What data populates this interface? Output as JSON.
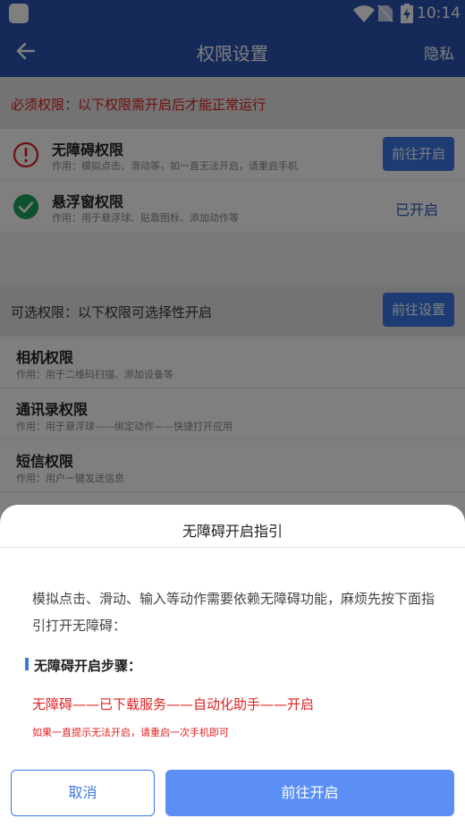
{
  "status_bar": {
    "time": "10:14"
  },
  "app_bar": {
    "title": "权限设置",
    "right_action": "隐私"
  },
  "required_section": {
    "header": "必须权限：以下权限需开启后才能正常运行",
    "items": [
      {
        "title": "无障碍权限",
        "desc": "作用：模拟点击、滑动等，如一直无法开启，请重启手机",
        "action": "前往开启",
        "state": "off",
        "icon": "alert-icon"
      },
      {
        "title": "悬浮窗权限",
        "desc": "作用：用于悬浮球、贴靠图标、添加动作等",
        "status": "已开启",
        "state": "on",
        "icon": "check-icon"
      }
    ]
  },
  "optional_section": {
    "header": "可选权限：以下权限可选择性开启",
    "action": "前往设置",
    "items": [
      {
        "title": "相机权限",
        "desc": "作用：用于二维码扫描、添加设备等"
      },
      {
        "title": "通讯录权限",
        "desc": "作用：用于悬浮球——绑定动作——快捷打开应用"
      },
      {
        "title": "短信权限",
        "desc": "作用：用户一键发送信息"
      }
    ]
  },
  "dialog": {
    "title": "无障碍开启指引",
    "body": "模拟点击、滑动、输入等动作需要依赖无障碍功能，麻烦先按下面指引打开无障碍：",
    "steps_title": "无障碍开启步骤：",
    "path": "无障碍——已下载服务——自动化助手——开启",
    "tip": "如果一直提示无法开启，请重启一次手机即可",
    "cancel": "取消",
    "confirm": "前往开启"
  },
  "colors": {
    "primary": "#2c55b5",
    "accent": "#3b78e6",
    "danger": "#e02020",
    "success": "#1aa35b"
  }
}
